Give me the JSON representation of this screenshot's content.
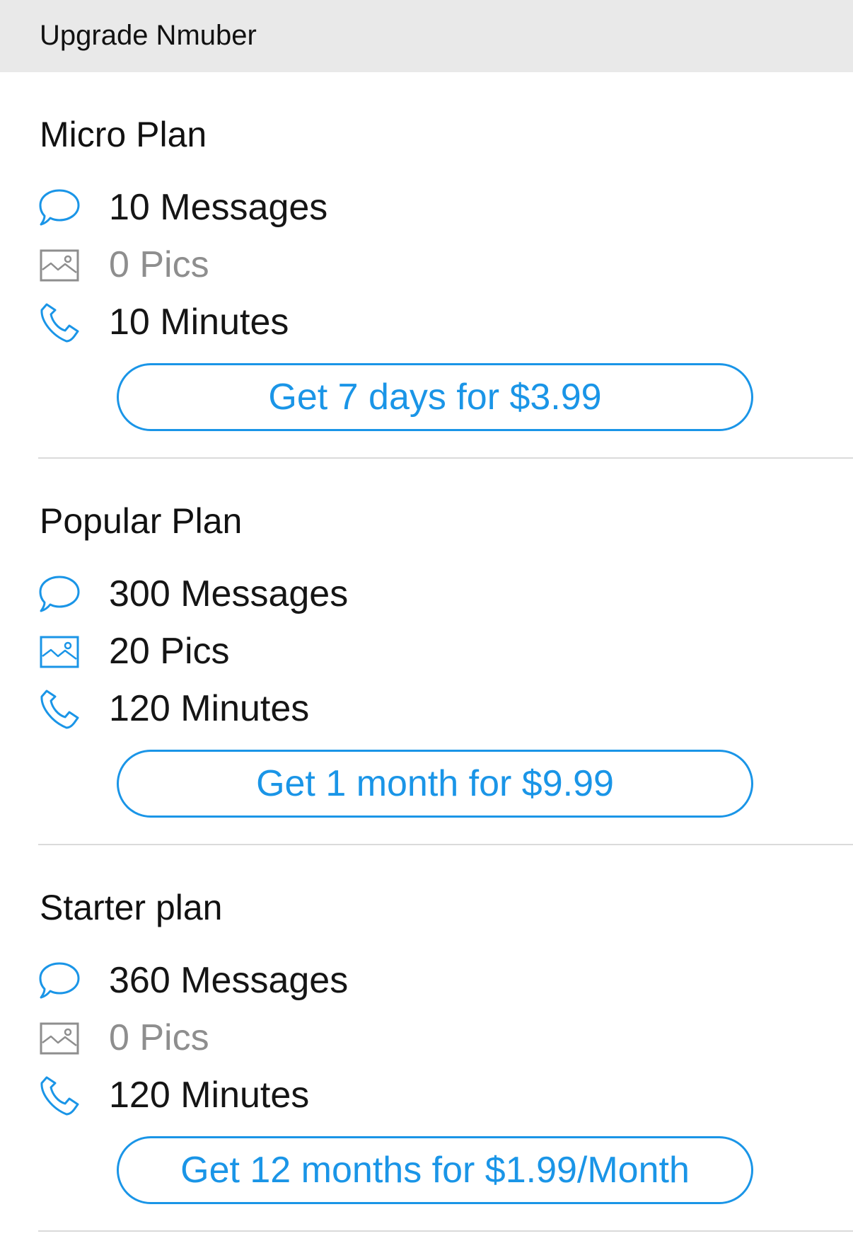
{
  "header": {
    "title": "Upgrade Nmuber"
  },
  "colors": {
    "accent": "#1a95e7",
    "muted_icon": "#8e8e8e",
    "header_bg": "#e9e9e9"
  },
  "plans": [
    {
      "title": "Micro Plan",
      "features": [
        {
          "icon": "message-bubble-icon",
          "label": "10 Messages",
          "enabled": true
        },
        {
          "icon": "picture-icon",
          "label": "0 Pics",
          "enabled": false
        },
        {
          "icon": "phone-icon",
          "label": "10 Minutes",
          "enabled": true
        }
      ],
      "button_label": "Get 7 days for $3.99"
    },
    {
      "title": "Popular Plan",
      "features": [
        {
          "icon": "message-bubble-icon",
          "label": "300 Messages",
          "enabled": true
        },
        {
          "icon": "picture-icon",
          "label": "20 Pics",
          "enabled": true
        },
        {
          "icon": "phone-icon",
          "label": "120 Minutes",
          "enabled": true
        }
      ],
      "button_label": "Get 1 month for $9.99"
    },
    {
      "title": "Starter plan",
      "features": [
        {
          "icon": "message-bubble-icon",
          "label": "360 Messages",
          "enabled": true
        },
        {
          "icon": "picture-icon",
          "label": "0 Pics",
          "enabled": false
        },
        {
          "icon": "phone-icon",
          "label": "120 Minutes",
          "enabled": true
        }
      ],
      "button_label": "Get 12 months for $1.99/Month"
    }
  ]
}
